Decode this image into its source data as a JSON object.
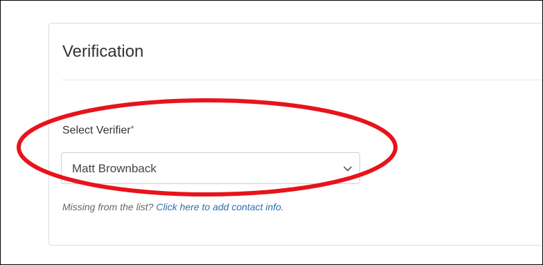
{
  "panel": {
    "title": "Verification"
  },
  "verifier_field": {
    "label": "Select Verifier",
    "required_marker": "*",
    "selected_value": "Matt Brownback"
  },
  "help": {
    "prefix": "Missing from the list?",
    "link_text": "Click here to add contact info."
  },
  "icons": {
    "dropdown": "chevron-down-icon"
  },
  "colors": {
    "annotation_ellipse": "#e8131b",
    "link": "#2a6fb0",
    "required": "#a94442"
  }
}
